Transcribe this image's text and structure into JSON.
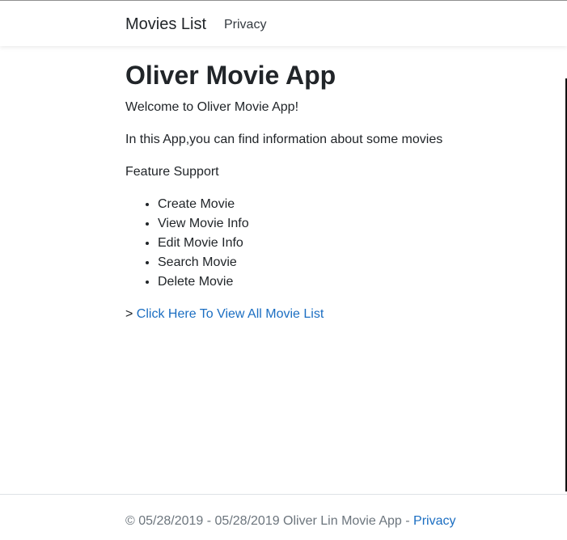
{
  "navbar": {
    "brand": "Movies List",
    "links": [
      {
        "label": "Privacy"
      }
    ]
  },
  "main": {
    "title": "Oliver Movie App",
    "welcome": "Welcome to Oliver Movie App!",
    "intro": "In this App,you can find information about some movies",
    "feature_heading": "Feature Support",
    "features": [
      "Create Movie",
      "View Movie Info",
      "Edit Movie Info",
      "Search Movie",
      "Delete Movie"
    ],
    "link_prefix": "> ",
    "link_label": "Click Here To View All Movie List"
  },
  "footer": {
    "text": "© 05/28/2019 - 05/28/2019 Oliver Lin Movie App - ",
    "link_label": "Privacy"
  },
  "colors": {
    "link": "#1b6ec2",
    "text": "#212529",
    "footer_text": "#6c757d"
  }
}
